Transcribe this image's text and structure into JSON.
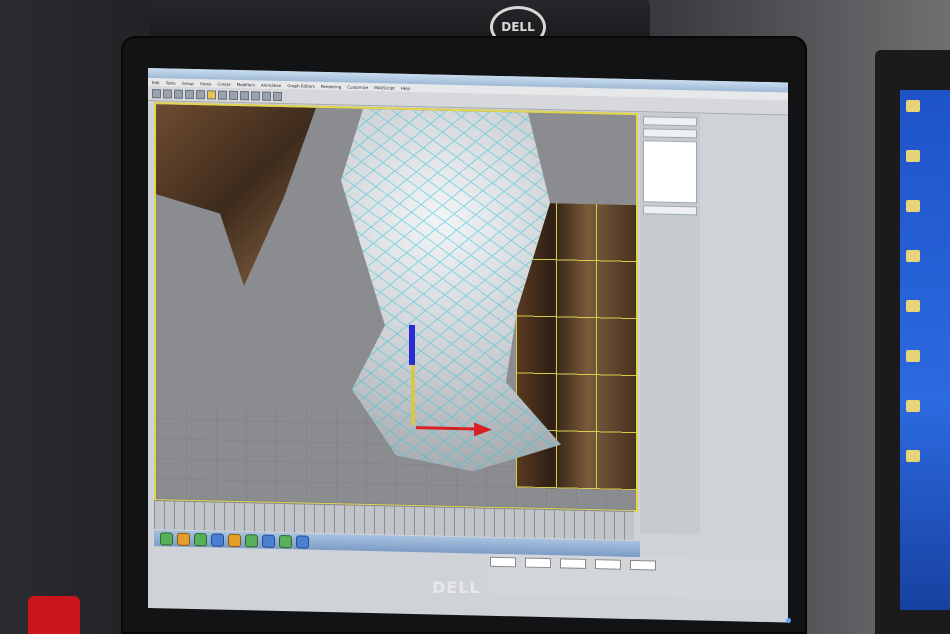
{
  "monitor": {
    "brand_front": "DELL",
    "brand_back": "DELL"
  },
  "app": {
    "menu": [
      "Edit",
      "Tools",
      "Group",
      "Views",
      "Create",
      "Modifiers",
      "Animation",
      "Graph Editors",
      "Rendering",
      "Customize",
      "MAXScript",
      "Help"
    ]
  },
  "colors": {
    "viewport_border": "#e4d64a",
    "wireframe": "#36c7d8",
    "axis_x": "#d62222",
    "axis_y": "#d9c64a",
    "axis_z": "#2b2bd6"
  }
}
